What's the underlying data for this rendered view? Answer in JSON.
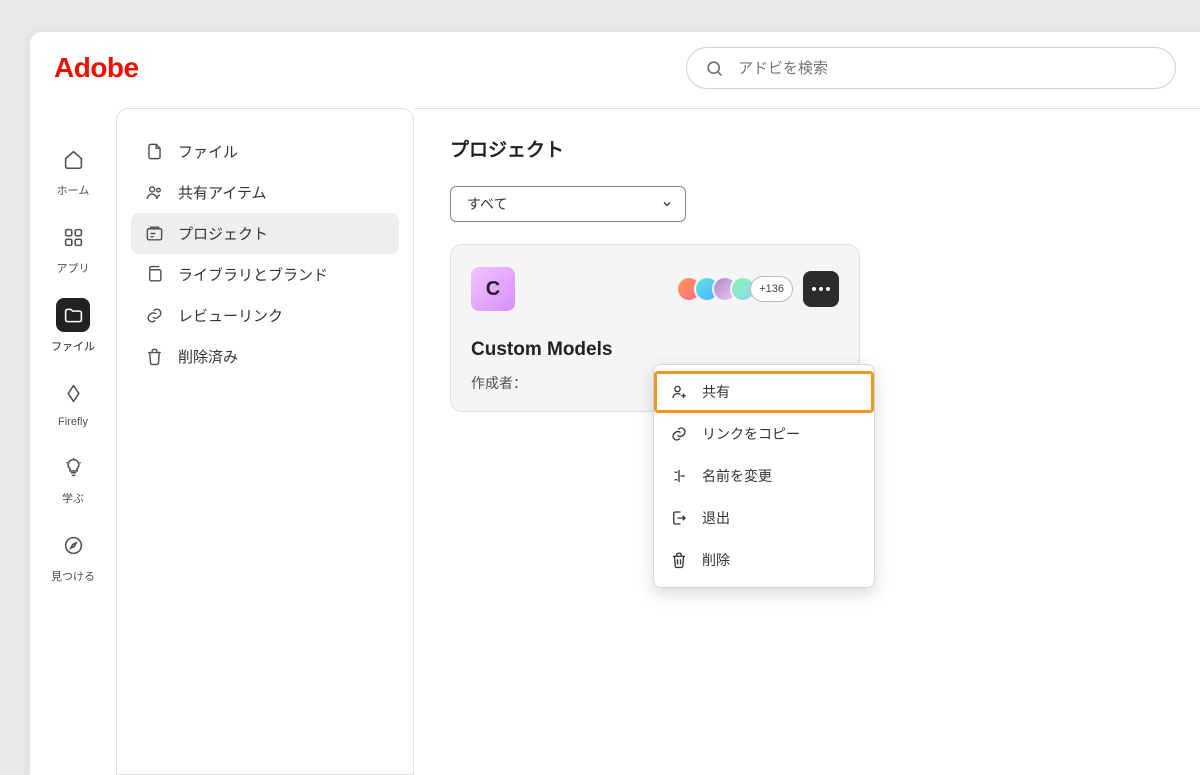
{
  "brand": "Adobe",
  "search": {
    "placeholder": "アドビを検索"
  },
  "rail": {
    "items": [
      {
        "id": "home",
        "label": "ホーム"
      },
      {
        "id": "apps",
        "label": "アプリ"
      },
      {
        "id": "files",
        "label": "ファイル"
      },
      {
        "id": "firefly",
        "label": "Firefly"
      },
      {
        "id": "learn",
        "label": "学ぶ"
      },
      {
        "id": "discover",
        "label": "見つける"
      }
    ]
  },
  "panel": {
    "items": [
      {
        "id": "files",
        "label": "ファイル"
      },
      {
        "id": "shared",
        "label": "共有アイテム"
      },
      {
        "id": "projects",
        "label": "プロジェクト"
      },
      {
        "id": "libraries",
        "label": "ライブラリとブランド"
      },
      {
        "id": "reviewlinks",
        "label": "レビューリンク"
      },
      {
        "id": "trash",
        "label": "削除済み"
      }
    ]
  },
  "main": {
    "heading": "プロジェクト",
    "filter": {
      "selected": "すべて"
    },
    "card": {
      "initial": "C",
      "title": "Custom Models",
      "creator_label": "作成者：",
      "creator_value": "",
      "extra_count": "+136"
    }
  },
  "menu": {
    "items": [
      {
        "id": "share",
        "label": "共有"
      },
      {
        "id": "copylink",
        "label": "リンクをコピー"
      },
      {
        "id": "rename",
        "label": "名前を変更"
      },
      {
        "id": "leave",
        "label": "退出"
      },
      {
        "id": "delete",
        "label": "削除"
      }
    ]
  }
}
